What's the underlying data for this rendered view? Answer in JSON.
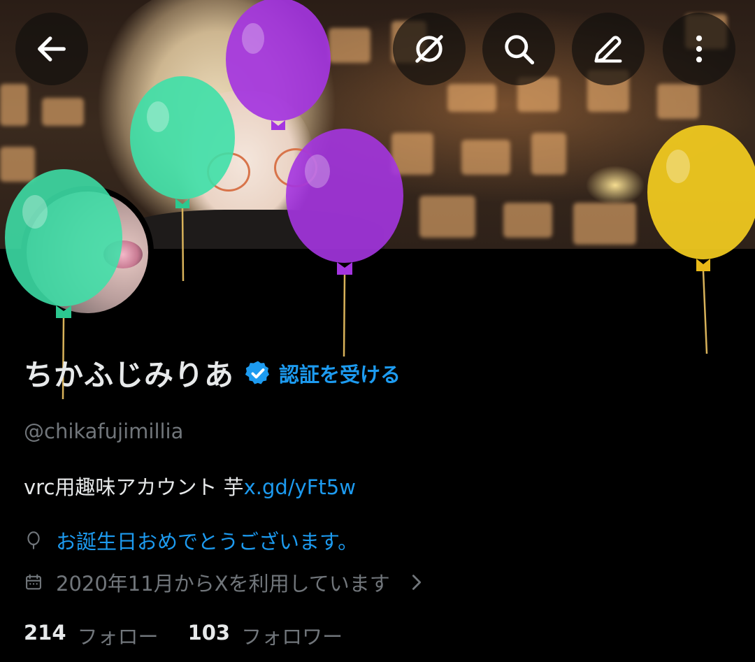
{
  "profile": {
    "name": "ちかふじみりあ",
    "get_verified": "認証を受ける",
    "handle": "@chikafujimillia",
    "bio_text": "vrc用趣味アカウント 芋",
    "bio_link": "x.gd/yFt5w",
    "birthday": "お誕生日おめでとうございます。",
    "joined": "2020年11月からXを利用しています",
    "following_count": "214",
    "following_label": "フォロー",
    "followers_count": "103",
    "followers_label": "フォロワー"
  },
  "icons": {
    "back": "arrow-left-icon",
    "grok": "slash-circle-icon",
    "search": "search-icon",
    "edit": "pencil-icon",
    "more": "more-vertical-icon",
    "verified": "verified-badge-icon",
    "birthday": "balloon-icon",
    "calendar": "calendar-icon",
    "chevron": "chevron-right-icon"
  },
  "colors": {
    "accent": "#1d9bf0",
    "muted": "#71767b",
    "balloon_green": "#3ee0a8",
    "balloon_purple": "#a435e0",
    "balloon_yellow": "#f4cd20"
  }
}
